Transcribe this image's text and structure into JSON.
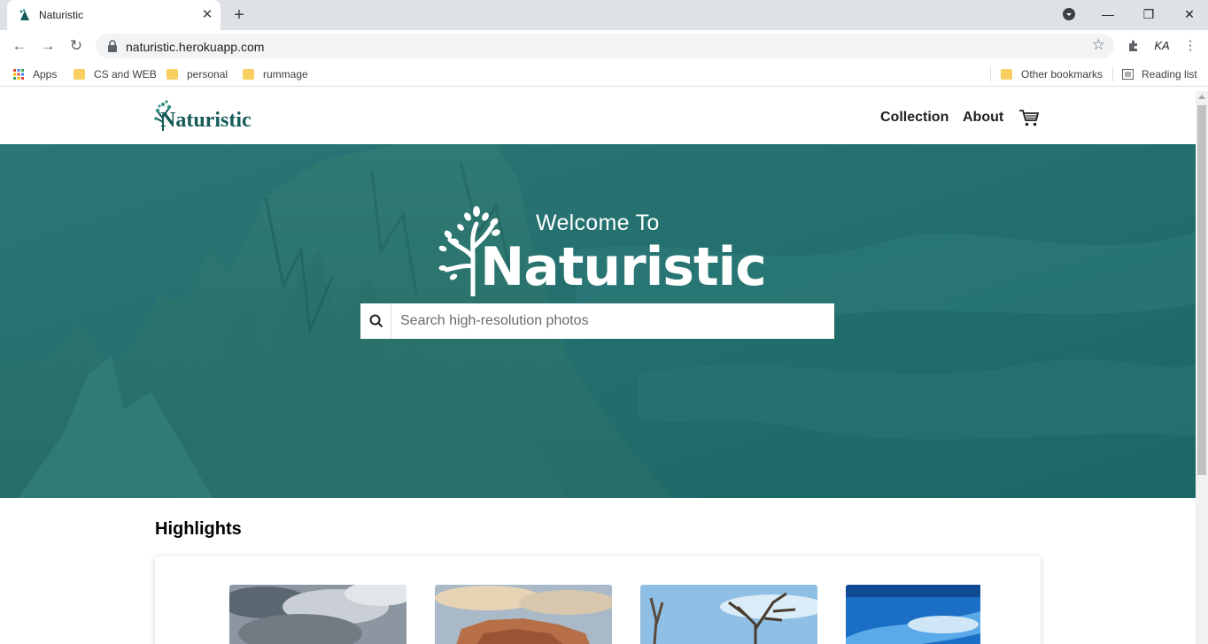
{
  "browser": {
    "tab_title": "Naturistic",
    "url": "naturistic.herokuapp.com",
    "profile_initials": "KA",
    "bookmarks": {
      "apps": "Apps",
      "items": [
        "CS and WEB",
        "personal",
        "rummage"
      ],
      "other": "Other bookmarks",
      "reading_list": "Reading list"
    }
  },
  "site": {
    "logo_text": "Naturistic",
    "nav": {
      "collection": "Collection",
      "about": "About"
    },
    "hero": {
      "welcome": "Welcome To",
      "brand": "Naturistic",
      "search_placeholder": "Search high-resolution photos"
    },
    "highlights_title": "Highlights"
  },
  "colors": {
    "brand_teal": "#155b58",
    "hero_overlay": "#1f6e6d"
  },
  "icons": [
    "search-icon",
    "cart-icon",
    "star-icon",
    "lock-icon",
    "extensions-icon",
    "menu-icon"
  ]
}
